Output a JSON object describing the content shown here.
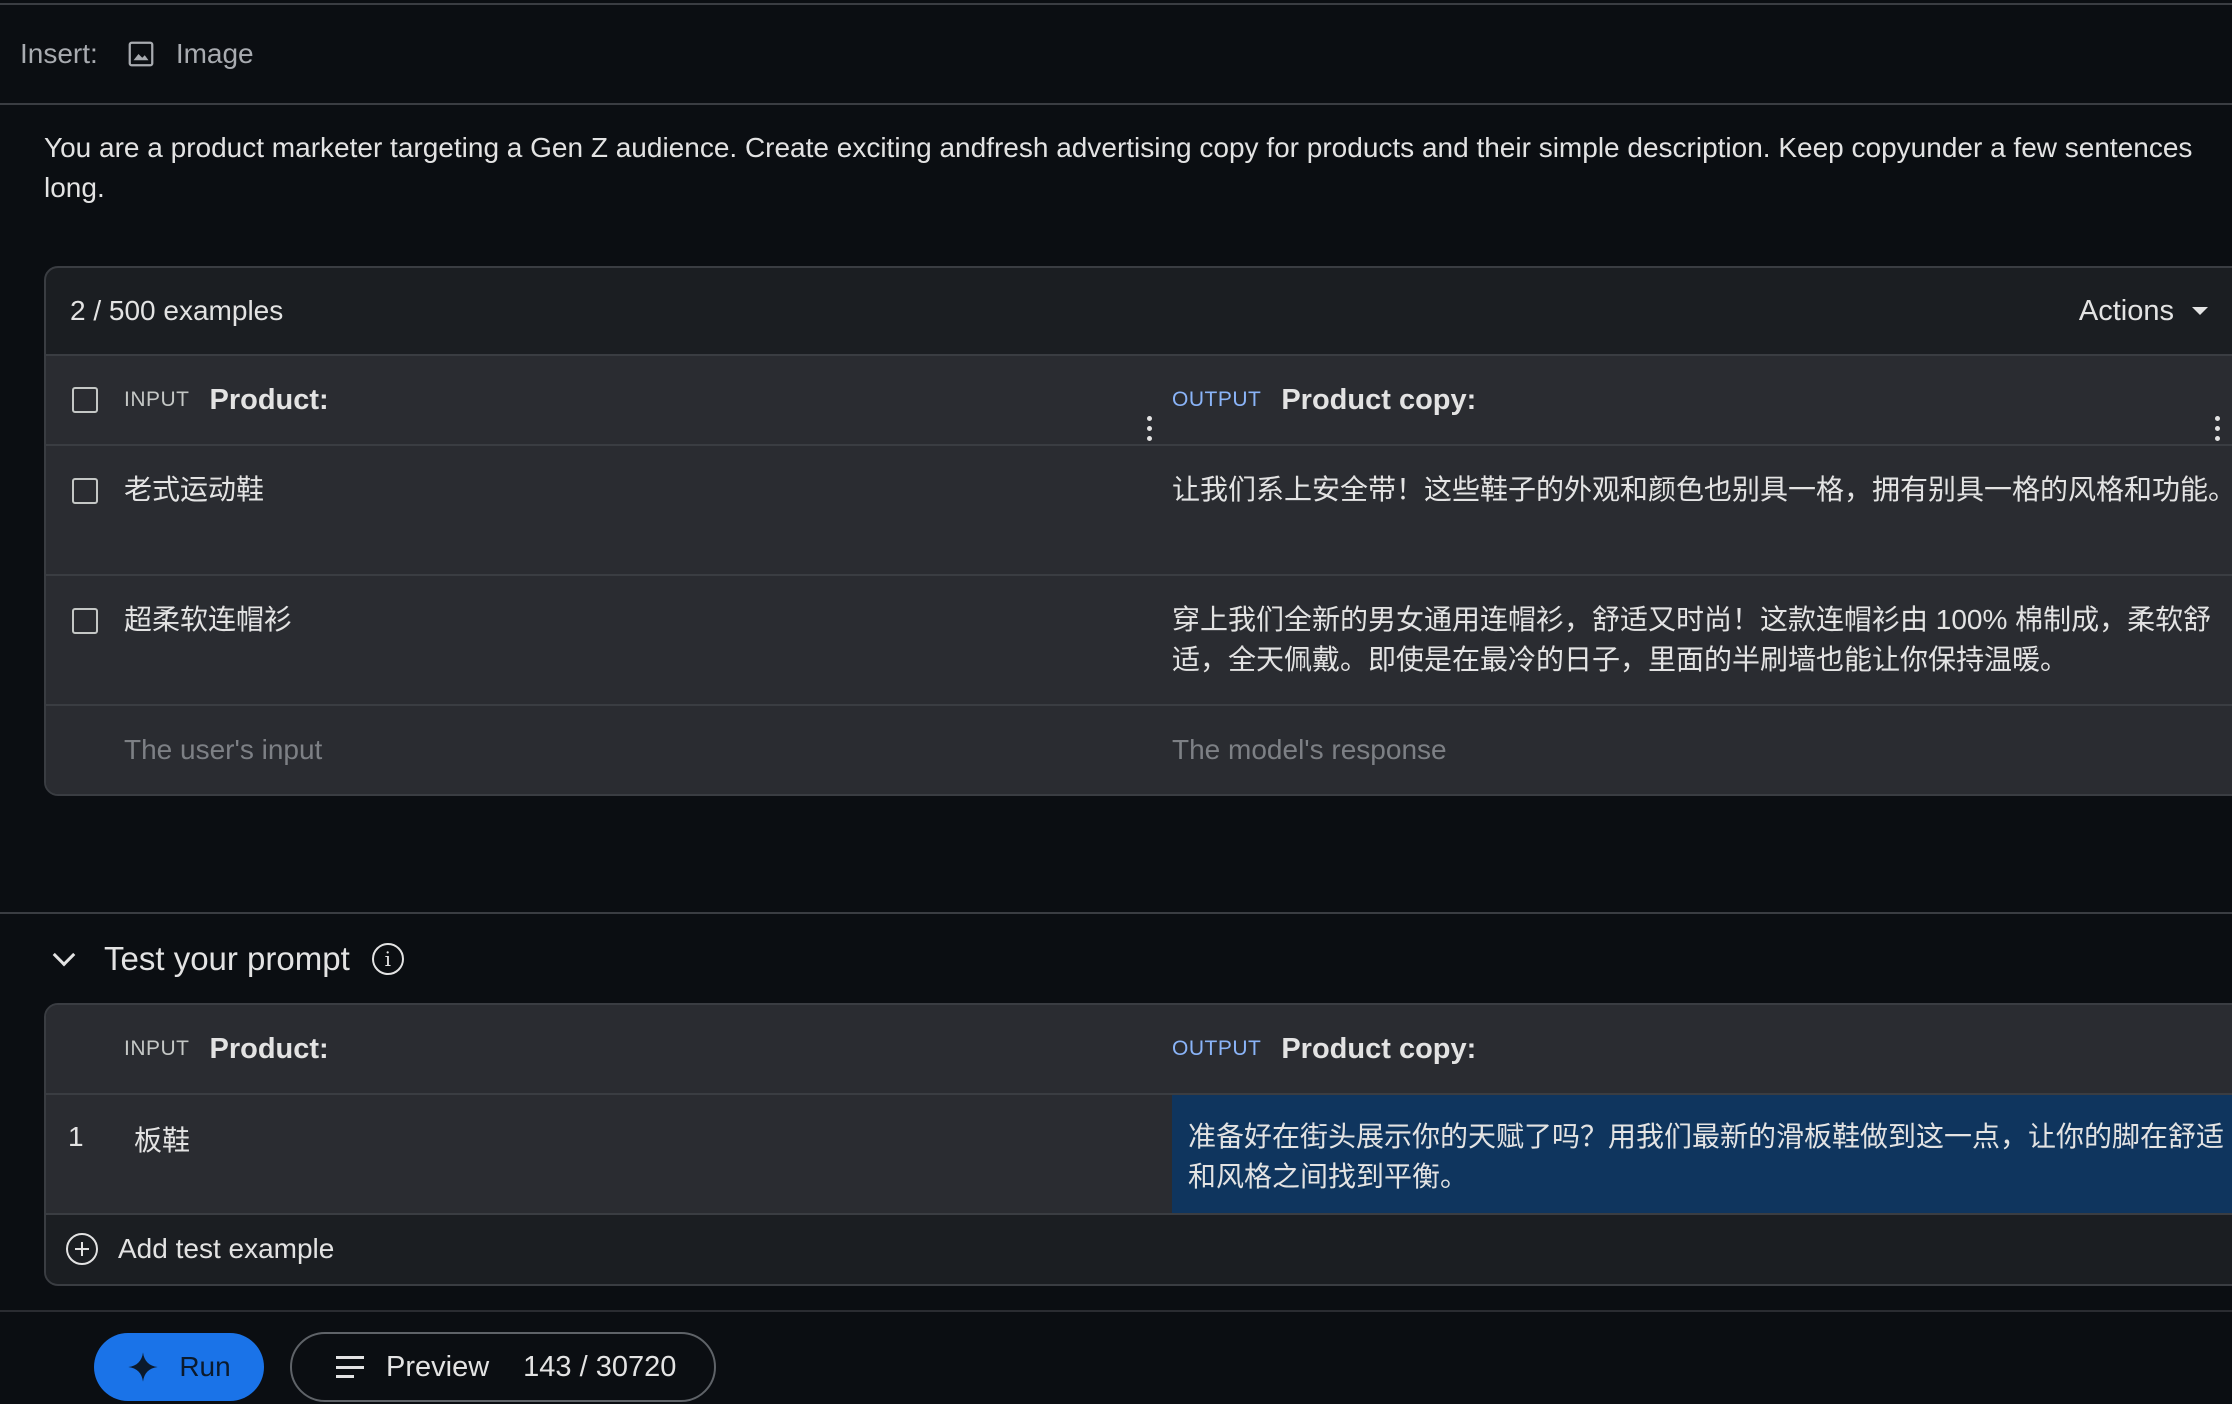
{
  "insert_bar": {
    "label": "Insert:",
    "image_button": "Image"
  },
  "system_instructions": "You are a product marketer targeting a Gen Z audience. Create exciting andfresh advertising copy for products and their simple description. Keep copyunder a few sentences long.",
  "examples": {
    "count": "2 / 500 examples",
    "actions_label": "Actions",
    "input_tag": "INPUT",
    "input_title": "Product:",
    "output_tag": "OUTPUT",
    "output_title": "Product copy:",
    "rows": [
      {
        "input": "老式运动鞋",
        "output": "让我们系上安全带！这些鞋子的外观和颜色也别具一格，拥有别具一格的风格和功能。"
      },
      {
        "input": "超柔软连帽衫",
        "output": "穿上我们全新的男女通用连帽衫，舒适又时尚！这款连帽衫由 100% 棉制成，柔软舒适，全天佩戴。即使是在最冷的日子，里面的半刷墙也能让你保持温暖。"
      }
    ],
    "input_placeholder": "The user's input",
    "output_placeholder": "The model's response"
  },
  "test": {
    "title": "Test your prompt",
    "input_tag": "INPUT",
    "input_title": "Product:",
    "output_tag": "OUTPUT",
    "output_title": "Product copy:",
    "rows": [
      {
        "number": "1",
        "input": "板鞋",
        "output": "准备好在街头展示你的天赋了吗？用我们最新的滑板鞋做到这一点，让你的脚在舒适和风格之间找到平衡。"
      }
    ],
    "add_label": "Add test example"
  },
  "footer": {
    "run_label": "Run",
    "preview_label": "Preview",
    "token_count": "143 / 30720"
  },
  "colors": {
    "background": "#0b0e12",
    "card": "#1b1e22",
    "row": "#2a2c31",
    "accent": "#1a73e8",
    "output_tag": "#8ab4f8",
    "selected_output": "#0f355e"
  }
}
